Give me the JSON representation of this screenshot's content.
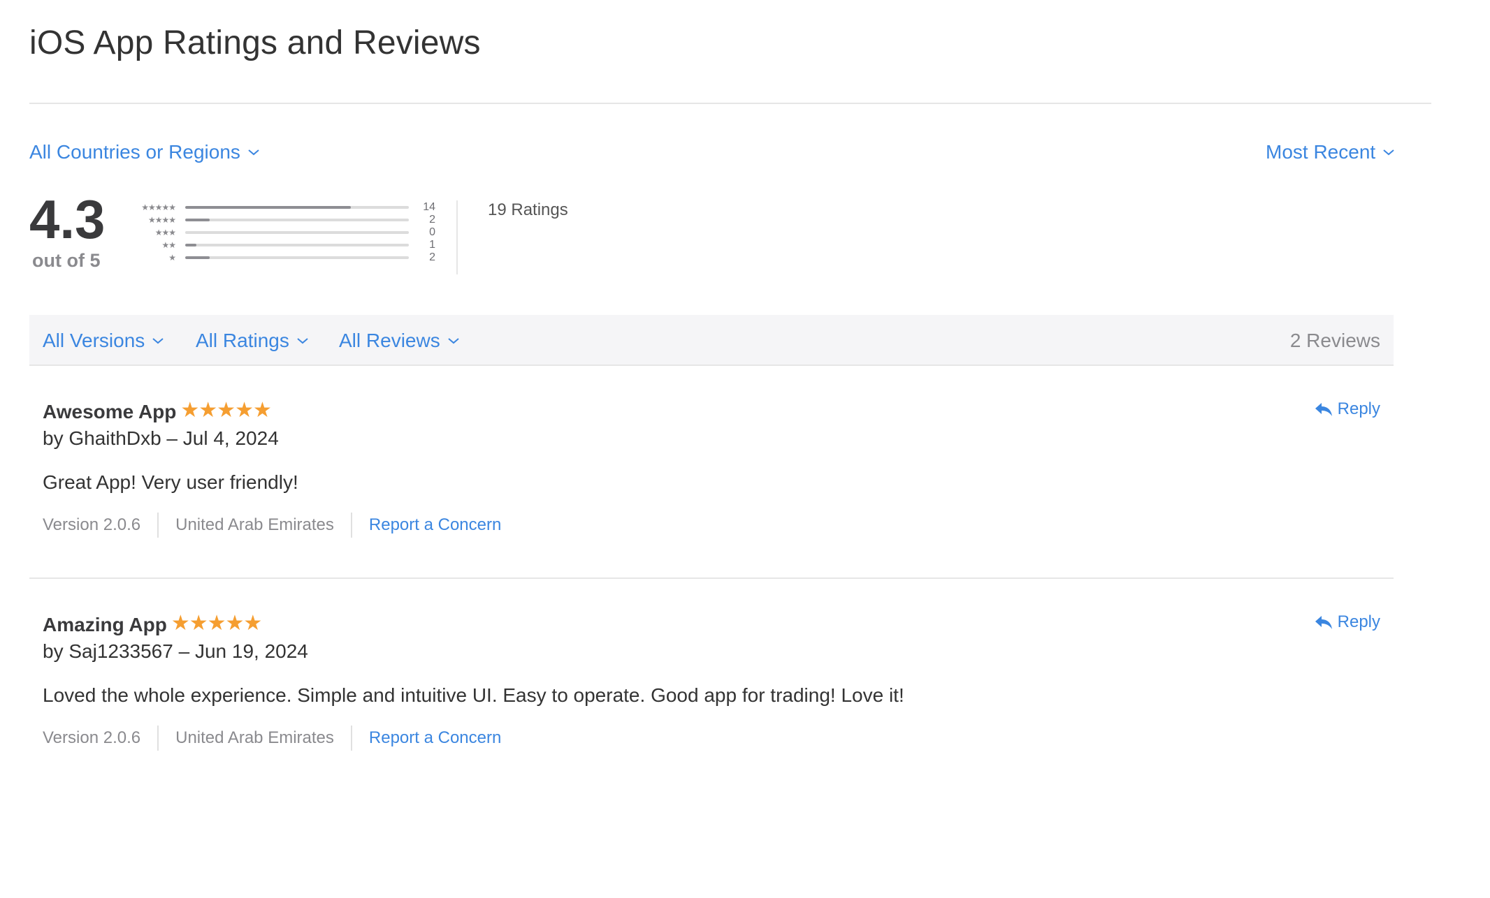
{
  "page": {
    "title": "iOS App Ratings and Reviews"
  },
  "filters": {
    "country": "All Countries or Regions",
    "sort": "Most Recent",
    "versions": "All Versions",
    "ratings": "All Ratings",
    "reviews": "All Reviews",
    "reviews_count": "2 Reviews"
  },
  "summary": {
    "average": "4.3",
    "out_of": "out of 5",
    "total_ratings": "19 Ratings",
    "histogram": [
      {
        "stars": "★★★★★",
        "count": "14",
        "fraction": 0.74
      },
      {
        "stars": "★★★★",
        "count": "2",
        "fraction": 0.11
      },
      {
        "stars": "★★★",
        "count": "0",
        "fraction": 0.0
      },
      {
        "stars": "★★",
        "count": "1",
        "fraction": 0.05
      },
      {
        "stars": "★",
        "count": "2",
        "fraction": 0.11
      }
    ]
  },
  "reviews": [
    {
      "title": "Awesome App",
      "stars": "★★★★★",
      "rating": 5,
      "meta": "by GhaithDxb – Jul 4, 2024",
      "body": "Great App! Very user friendly!",
      "version": "Version 2.0.6",
      "country": "United Arab Emirates",
      "report_label": "Report a Concern",
      "reply_label": "Reply"
    },
    {
      "title": "Amazing App",
      "stars": "★★★★★",
      "rating": 5,
      "meta": "by Saj1233567 – Jun 19, 2024",
      "body": "Loved the whole experience. Simple and intuitive UI. Easy to operate. Good app for trading! Love it!",
      "version": "Version 2.0.6",
      "country": "United Arab Emirates",
      "report_label": "Report a Concern",
      "reply_label": "Reply"
    }
  ],
  "icons": {
    "dropdown": "chevron-down-icon",
    "reply": "reply-arrow-icon",
    "star": "star-icon"
  },
  "colors": {
    "link": "#3b86e0",
    "star": "#f59e31",
    "filter_bar_bg": "#f5f5f7"
  }
}
